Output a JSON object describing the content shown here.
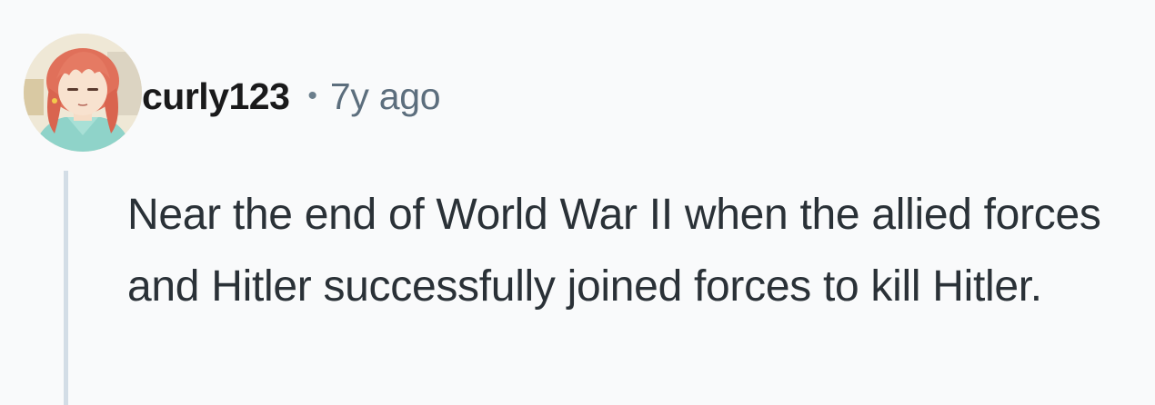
{
  "comment": {
    "author": "curly123",
    "separator": "•",
    "timestamp": "7y ago",
    "body": "Near the end of World War II when the allied forces and Hitler successfully joined forces to kill Hitler.",
    "avatar_icon": "user-avatar-icon",
    "colors": {
      "background": "#f9fafb",
      "thread_line": "#d3dde6",
      "author": "#1a1a1b",
      "meta": "#5c6e7d",
      "body": "#2a3137"
    }
  }
}
